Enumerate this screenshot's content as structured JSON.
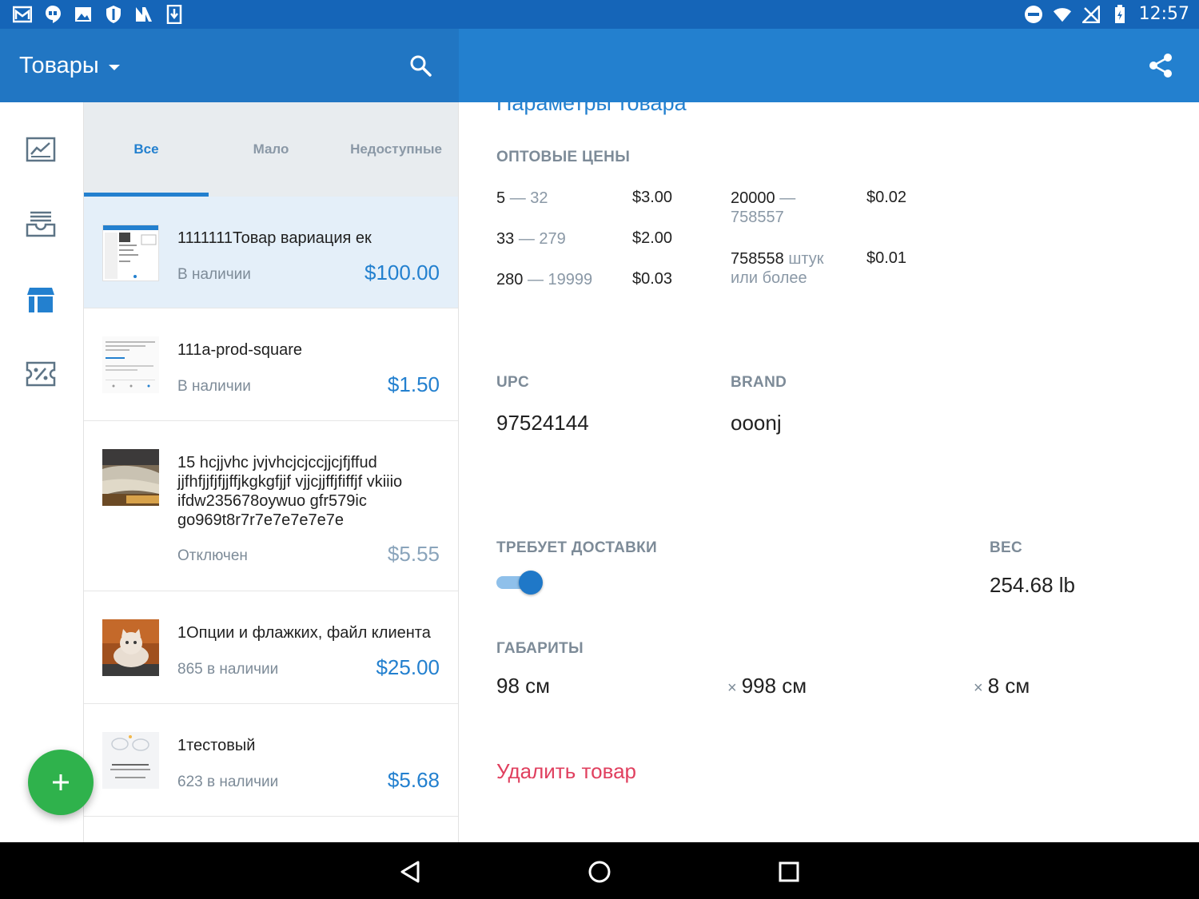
{
  "status_bar": {
    "time": "12:57",
    "left_icons": [
      "mail-icon",
      "hangouts-icon",
      "image-icon",
      "shield-icon",
      "n-app-icon",
      "download-icon"
    ],
    "right_icons": [
      "dnd-icon",
      "wifi-icon",
      "no-signal-icon",
      "battery-charging-icon"
    ]
  },
  "app_bar": {
    "title": "Товары",
    "search_icon": "search-icon",
    "share_icon": "share-icon",
    "color": "#2380cf"
  },
  "rail": {
    "items": [
      {
        "icon": "analytics-icon",
        "active": false
      },
      {
        "icon": "orders-icon",
        "active": false
      },
      {
        "icon": "products-box-icon",
        "active": true
      },
      {
        "icon": "discount-icon",
        "active": false
      }
    ]
  },
  "tabs": [
    {
      "label": "Все",
      "active": true
    },
    {
      "label": "Мало",
      "active": false
    },
    {
      "label": "Недоступные",
      "active": false
    }
  ],
  "products": [
    {
      "name": "1111111Товар вариация ек",
      "stock": "В наличии",
      "price": "$100.00",
      "selected": true,
      "thumb": "screenshot-thumb"
    },
    {
      "name": "111a-prod-square",
      "stock": "В наличии",
      "price": "$1.50",
      "selected": false,
      "thumb": "document-thumb"
    },
    {
      "name": "15 hcjjvhc jvjvhcjcjccjjcjfjffud jjfhfjjfjfjjffjkgkgfjjf vjjcjjffjfiffjf vkiiio  ifdw235678oywuo gfr579ic go969t8r7r7e7e7e7e7e",
      "stock": "Отключен",
      "price": "$5.55",
      "selected": false,
      "thumb": "photo-thumb"
    },
    {
      "name": "1Опции и флажких, файл клиента",
      "stock": "865 в наличии",
      "price": "$25.00",
      "selected": false,
      "thumb": "kitten-photo-thumb"
    },
    {
      "name": "1тестовый",
      "stock": "623 в наличии",
      "price": "$5.68",
      "selected": false,
      "thumb": "clouds-thumb"
    }
  ],
  "fab": {
    "icon": "plus-icon",
    "color": "#2fb24c"
  },
  "detail": {
    "section_title": "Параметры товара",
    "wholesale_label": "ОПТОВЫЕ ЦЕНЫ",
    "tiers_left": [
      {
        "from": "5",
        "to": "32",
        "price": "$3.00"
      },
      {
        "from": "33",
        "to": "279",
        "price": "$2.00"
      },
      {
        "from": "280",
        "to": "19999",
        "price": "$0.03"
      }
    ],
    "tiers_right": [
      {
        "from": "20000",
        "to": "758557",
        "price": "$0.02"
      },
      {
        "from": "758558",
        "suffix": "штук или более",
        "price": "$0.01"
      }
    ],
    "dash": "—",
    "upc_label": "UPC",
    "upc_value": "97524144",
    "brand_label": "BRAND",
    "brand_value": "ooonj",
    "shipping_label": "ТРЕБУЕТ ДОСТАВКИ",
    "shipping_enabled": true,
    "weight_label": "ВЕС",
    "weight_value": "254.68 lb",
    "dimensions_label": "ГАБАРИТЫ",
    "dimensions": [
      "98 см",
      "998 см",
      "8 см"
    ],
    "times_sign": "×",
    "delete_label": "Удалить товар",
    "delete_color": "#e0405f"
  },
  "nav_bar": {
    "back_icon": "back-icon",
    "home_icon": "home-icon",
    "recents_icon": "recents-icon"
  }
}
